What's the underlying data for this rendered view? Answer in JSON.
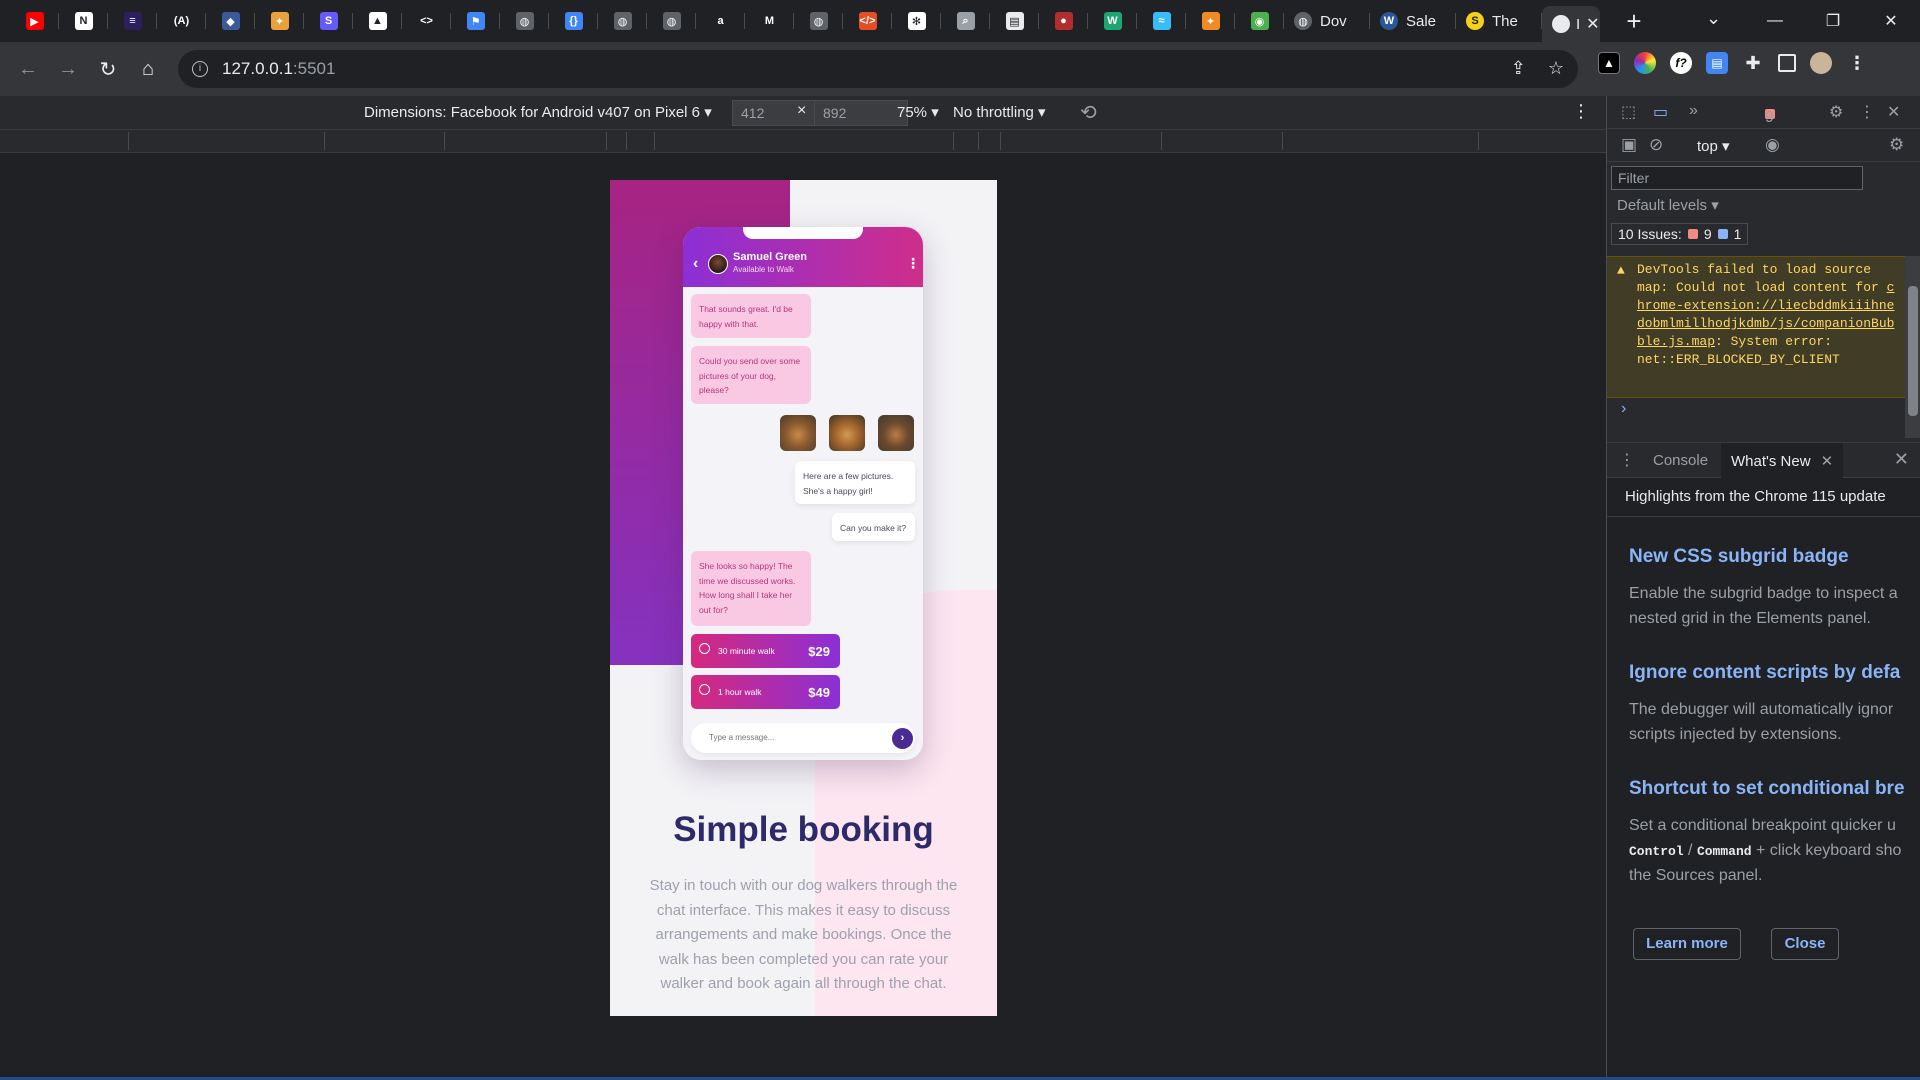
{
  "browser": {
    "tabs_favicons": [
      {
        "name": "youtube",
        "color": "#ff0000",
        "glyph": "▶"
      },
      {
        "name": "notion",
        "color": "#ffffff",
        "glyph": "N"
      },
      {
        "name": "slides",
        "color": "#2d1f5e",
        "glyph": "≡"
      },
      {
        "name": "codepen-a",
        "color": "#202124",
        "glyph": "(A)"
      },
      {
        "name": "shield",
        "color": "#3b5998",
        "glyph": "◆"
      },
      {
        "name": "cat",
        "color": "#e9a13b",
        "glyph": "✦"
      },
      {
        "name": "stripe-s",
        "color": "#635bff",
        "glyph": "S"
      },
      {
        "name": "vercel",
        "color": "#ffffff",
        "glyph": "▲"
      },
      {
        "name": "code-brackets",
        "color": "#202124",
        "glyph": "<>"
      },
      {
        "name": "flag",
        "color": "#4285f4",
        "glyph": "⚑"
      },
      {
        "name": "globe",
        "color": "#5f6368",
        "glyph": "◍"
      },
      {
        "name": "curly",
        "color": "#4285f4",
        "glyph": "{}"
      },
      {
        "name": "globe",
        "color": "#5f6368",
        "glyph": "◍"
      },
      {
        "name": "globe",
        "color": "#5f6368",
        "glyph": "◍"
      },
      {
        "name": "amazon-a",
        "color": "#202124",
        "glyph": "a"
      },
      {
        "name": "medium-m",
        "color": "#202124",
        "glyph": "M"
      },
      {
        "name": "globe",
        "color": "#5f6368",
        "glyph": "◍"
      },
      {
        "name": "html-tag",
        "color": "#e44d26",
        "glyph": "</>"
      },
      {
        "name": "openai",
        "color": "#ffffff",
        "glyph": "✻"
      },
      {
        "name": "magnifier",
        "color": "#9aa0a6",
        "glyph": "⌕"
      },
      {
        "name": "doc",
        "color": "#e8eaed",
        "glyph": "▤"
      },
      {
        "name": "ball",
        "color": "#b32d2e",
        "glyph": "●"
      },
      {
        "name": "w-logo",
        "color": "#1ea672",
        "glyph": "W"
      },
      {
        "name": "tailwind",
        "color": "#38bdf8",
        "glyph": "≈"
      },
      {
        "name": "orange-bird",
        "color": "#f08a24",
        "glyph": "✦"
      },
      {
        "name": "frog",
        "color": "#4caf50",
        "glyph": "◉"
      }
    ],
    "tabs_labeled": [
      {
        "label": "Dov",
        "color": "#5f6368",
        "glyph": "◍"
      },
      {
        "label": "Sale",
        "color": "#2b579a",
        "glyph": "W"
      },
      {
        "label": "The",
        "color": "#f7d117",
        "glyph": "S"
      }
    ],
    "active_tab_label": "I",
    "new_tab_glyph": "+",
    "url_host": "127.0.0.1",
    "url_port": ":5501"
  },
  "device_toolbar": {
    "device": "Dimensions: Facebook for Android v407 on Pixel 6",
    "width": "412",
    "height": "892",
    "times": "×",
    "zoom": "75%",
    "throttle": "No throttling"
  },
  "mobile_page": {
    "chat": {
      "contact_name": "Samuel Green",
      "contact_status": "Available to Walk",
      "messages": [
        {
          "dir": "in",
          "text": "That sounds great. I'd be happy with that."
        },
        {
          "dir": "in",
          "text": "Could you send over some pictures of your dog, please?"
        },
        {
          "dir": "out",
          "text": "Here are a few pictures. She's a happy girl!"
        },
        {
          "dir": "out",
          "text": "Can you make it?"
        },
        {
          "dir": "in",
          "text": "She looks so happy! The time we discussed works. How long shall I take her out for?"
        }
      ],
      "options": [
        {
          "label": "30 minute walk",
          "price": "$29"
        },
        {
          "label": "1 hour walk",
          "price": "$49"
        }
      ],
      "message_placeholder": "Type a message..."
    },
    "heading": "Simple booking",
    "paragraph": "Stay in touch with our dog walkers through the chat interface. This makes it easy to discuss arrangements and make bookings. Once the walk has been completed you can rate your walker and book again all through the chat."
  },
  "devtools": {
    "error_count": "9",
    "context": "top",
    "filter_placeholder": "Filter",
    "levels": "Default levels",
    "issues_label": "10 Issues:",
    "issues_errors": "9",
    "issues_info": "1",
    "warning_prefix": "DevTools failed to load source map: Could not load content for ",
    "warning_link": "chrome-extension://liecbddmkiiihnedobmlmillhodjkdmb/js/companionBubble.js.map",
    "warning_suffix": ": System error: net::ERR_BLOCKED_BY_CLIENT",
    "drawer_tabs": {
      "console": "Console",
      "whats_new": "What's New"
    },
    "whats_new": {
      "subtitle": "Highlights from the Chrome 115 update",
      "h1": "New CSS subgrid badge",
      "p1_l1": "Enable the subgrid badge to inspect a",
      "p1_l2": "nested grid in the Elements panel.",
      "h2": "Ignore content scripts by defa",
      "p2_l1": "The debugger will automatically ignor",
      "p2_l2": "scripts injected by extensions.",
      "h3": "Shortcut to set conditional bre",
      "p3_l1": "Set a conditional breakpoint quicker u",
      "p3_code1": "Control",
      "p3_sep": " / ",
      "p3_code2": "Command",
      "p3_l2_rest": " + click keyboard sho",
      "p3_l3": "the Sources panel.",
      "learn_more": "Learn more",
      "close": "Close"
    }
  }
}
